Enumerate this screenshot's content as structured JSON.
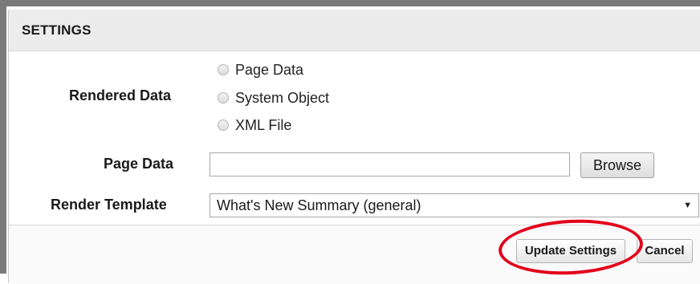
{
  "header": {
    "title": "SETTINGS"
  },
  "rendered_data": {
    "label": "Rendered Data",
    "options": [
      "Page Data",
      "System Object",
      "XML File"
    ]
  },
  "page_data": {
    "label": "Page Data",
    "value": "",
    "browse_label": "Browse"
  },
  "render_template": {
    "label": "Render Template",
    "selected": "What's New Summary (general)"
  },
  "footer": {
    "update_label": "Update Settings",
    "cancel_label": "Cancel"
  },
  "colors": {
    "highlight": "#e3001b",
    "header_bg": "#ececec"
  }
}
